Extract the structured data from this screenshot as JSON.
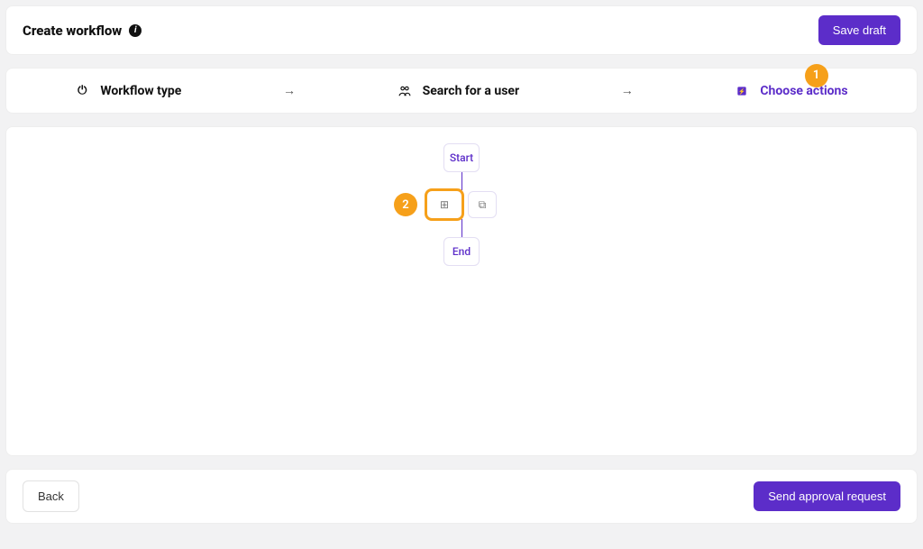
{
  "header": {
    "title": "Create workflow",
    "save_label": "Save draft"
  },
  "steps": {
    "s1": "Workflow type",
    "s2": "Search for a user",
    "s3": "Choose actions"
  },
  "flow": {
    "start": "Start",
    "end": "End",
    "add_symbol": "⊞",
    "copy_symbol": "⧉"
  },
  "footer": {
    "back": "Back",
    "submit": "Send approval request"
  },
  "callouts": {
    "one": "1",
    "two": "2"
  },
  "colors": {
    "accent": "#5c2dc9",
    "highlight": "#f6a01a"
  }
}
